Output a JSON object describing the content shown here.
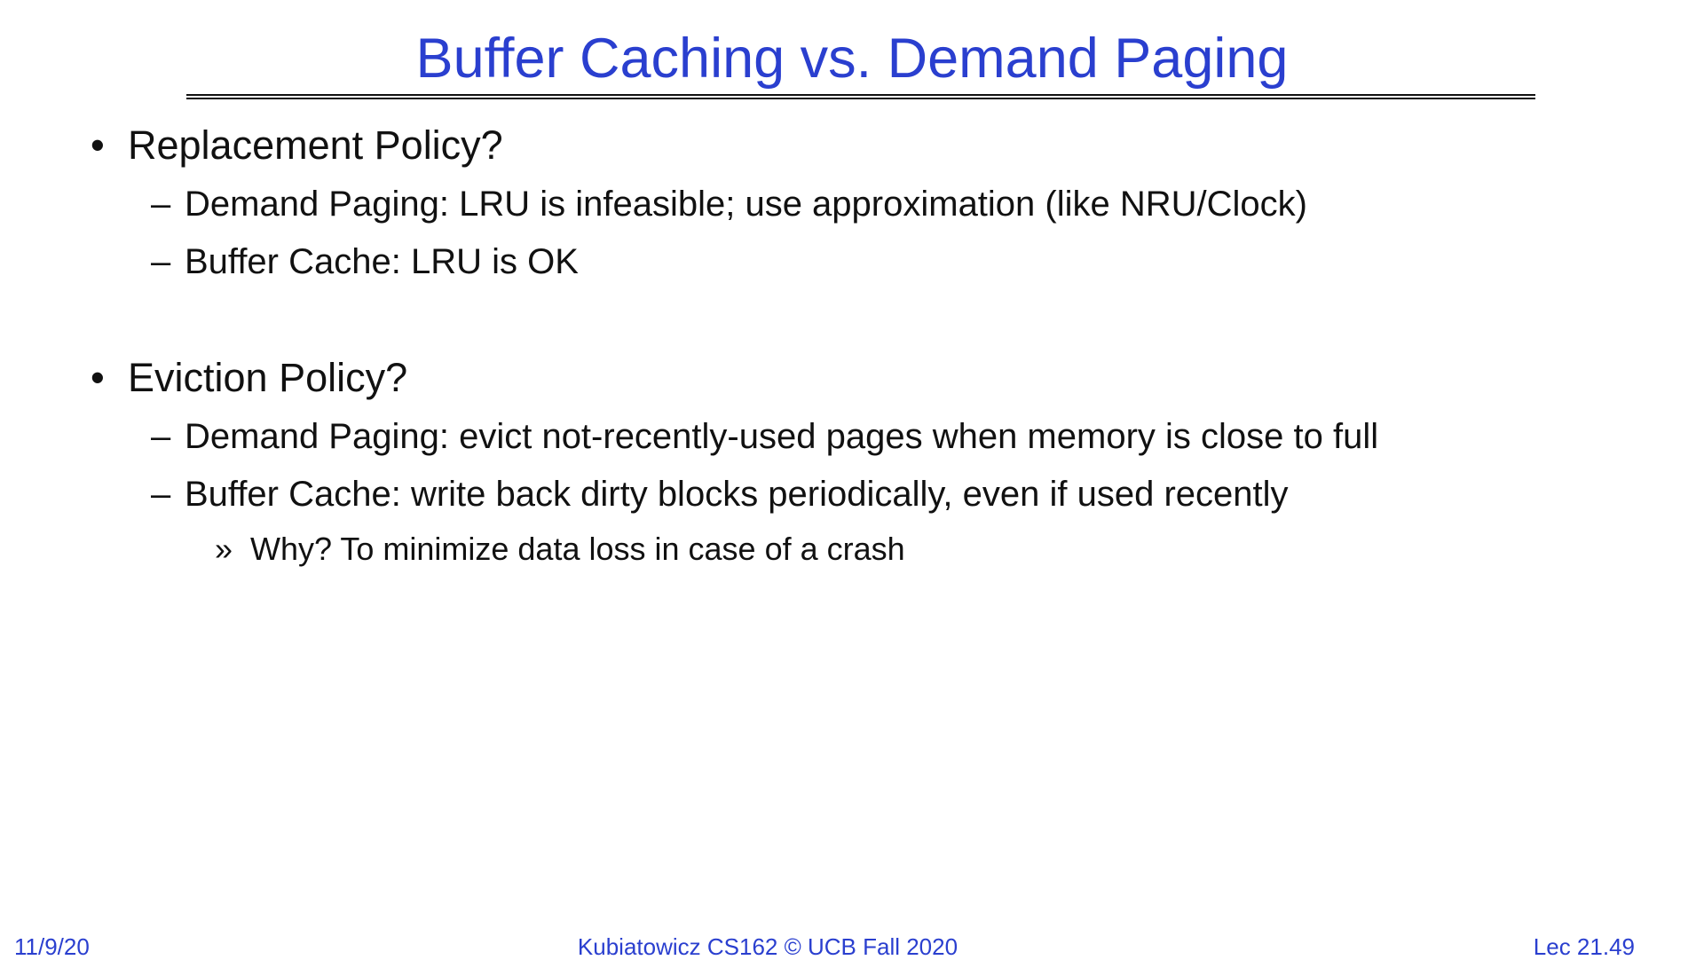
{
  "slide": {
    "title": "Buffer Caching vs. Demand Paging"
  },
  "content": {
    "bullets": [
      {
        "marker": "•",
        "text": "Replacement Policy?",
        "subs": [
          {
            "marker": "–",
            "text": "Demand Paging: LRU is infeasible; use approximation (like NRU/Clock)"
          },
          {
            "marker": "–",
            "text": "Buffer Cache: LRU is OK"
          }
        ]
      },
      {
        "marker": "•",
        "text": "Eviction Policy?",
        "subs": [
          {
            "marker": "–",
            "text": "Demand Paging: evict not-recently-used pages when memory is close to full"
          },
          {
            "marker": "–",
            "text": "Buffer Cache: write back dirty blocks periodically, even if used recently",
            "subs": [
              {
                "marker": "»",
                "text": "Why? To minimize data loss in case of a crash"
              }
            ]
          }
        ]
      }
    ]
  },
  "footer": {
    "date": "11/9/20",
    "course": "Kubiatowicz CS162 © UCB Fall 2020",
    "lecture": "Lec 21.49"
  }
}
